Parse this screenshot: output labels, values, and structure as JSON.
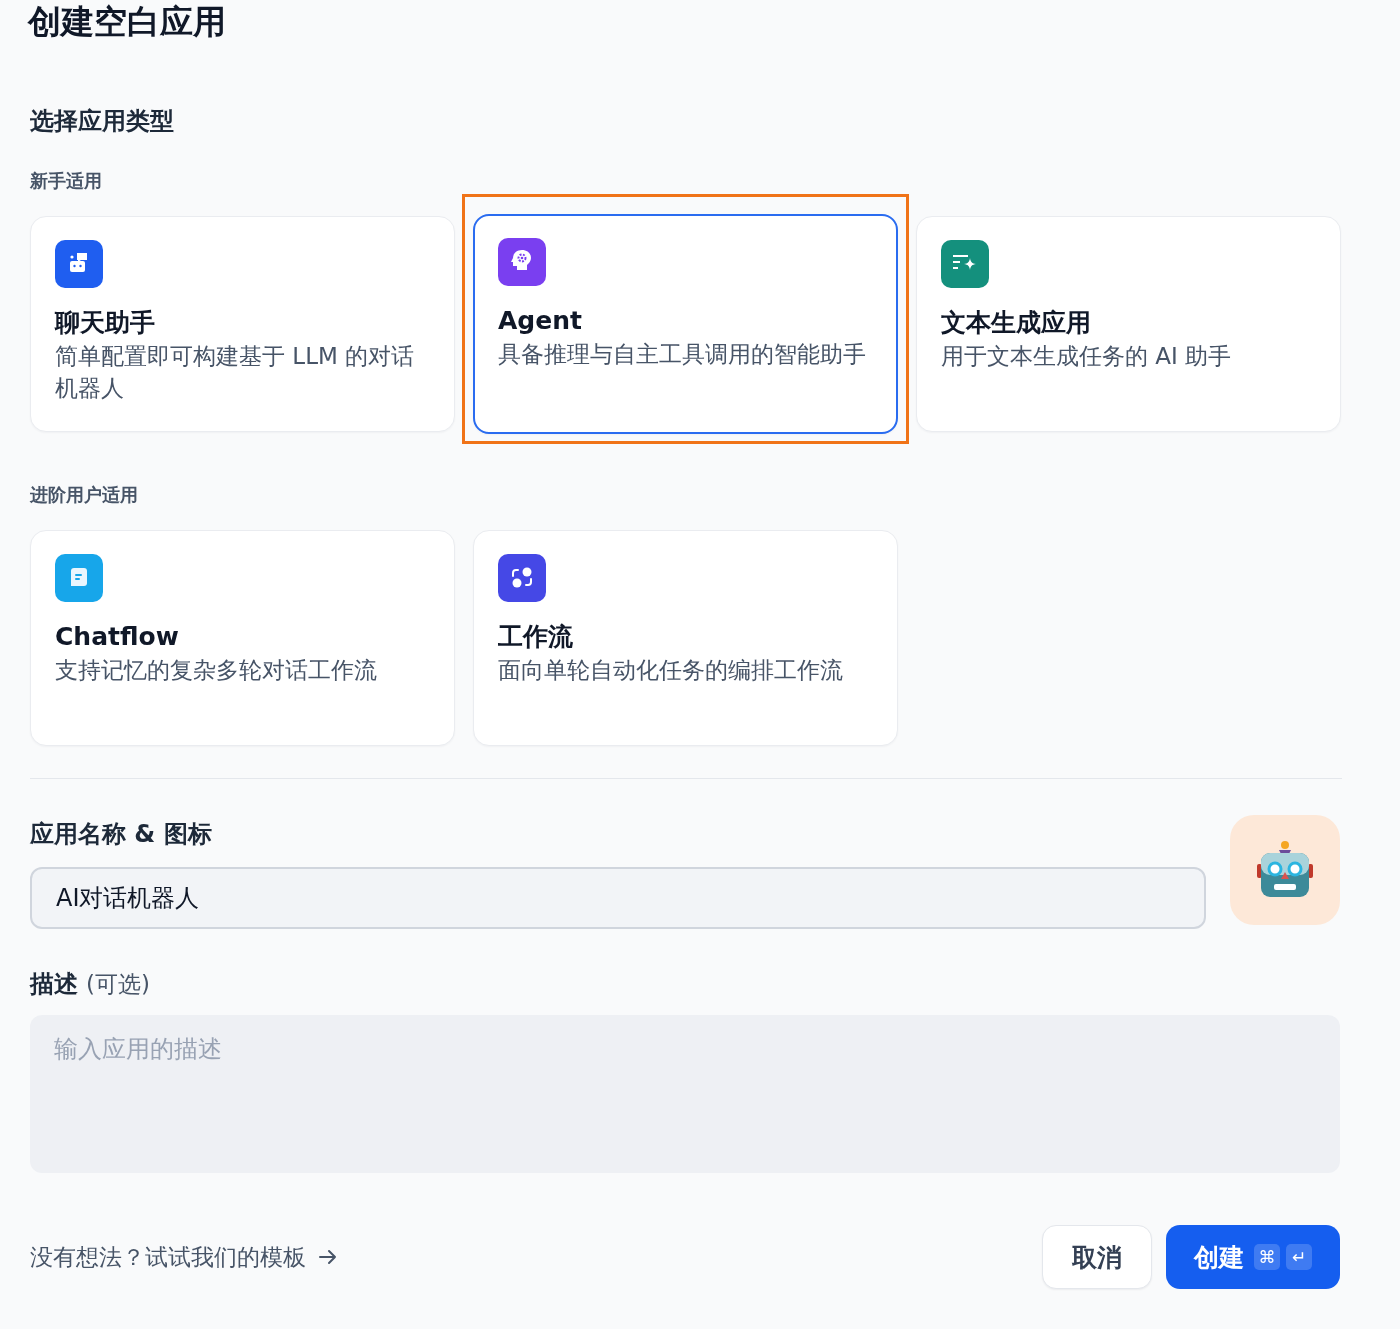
{
  "title": "创建空白应用",
  "section_title": "选择应用类型",
  "groups": [
    {
      "label": "新手适用",
      "apps": [
        {
          "kind": "chat",
          "name": "聊天助手",
          "description": "简单配置即可构建基于 LLM 的对话机器人",
          "selected": false,
          "highlighted": false
        },
        {
          "kind": "agent",
          "name": "Agent",
          "description": "具备推理与自主工具调用的智能助手",
          "selected": true,
          "highlighted": true
        },
        {
          "kind": "text",
          "name": "文本生成应用",
          "description": "用于文本生成任务的 AI 助手",
          "selected": false,
          "highlighted": false
        }
      ]
    },
    {
      "label": "进阶用户适用",
      "apps": [
        {
          "kind": "chatflow",
          "name": "Chatflow",
          "description": "支持记忆的复杂多轮对话工作流",
          "selected": false,
          "highlighted": false
        },
        {
          "kind": "workflow",
          "name": "工作流",
          "description": "面向单轮自动化任务的编排工作流",
          "selected": false,
          "highlighted": false
        }
      ]
    }
  ],
  "name_field": {
    "label": "应用名称 & 图标",
    "value": "AI对话机器人"
  },
  "description_field": {
    "label": "描述",
    "optional": "(可选)",
    "placeholder": "输入应用的描述"
  },
  "template_link": "没有想法？试试我们的模板",
  "buttons": {
    "cancel": "取消",
    "create": "创建",
    "shortcut_keys": [
      "⌘",
      "↵"
    ]
  }
}
